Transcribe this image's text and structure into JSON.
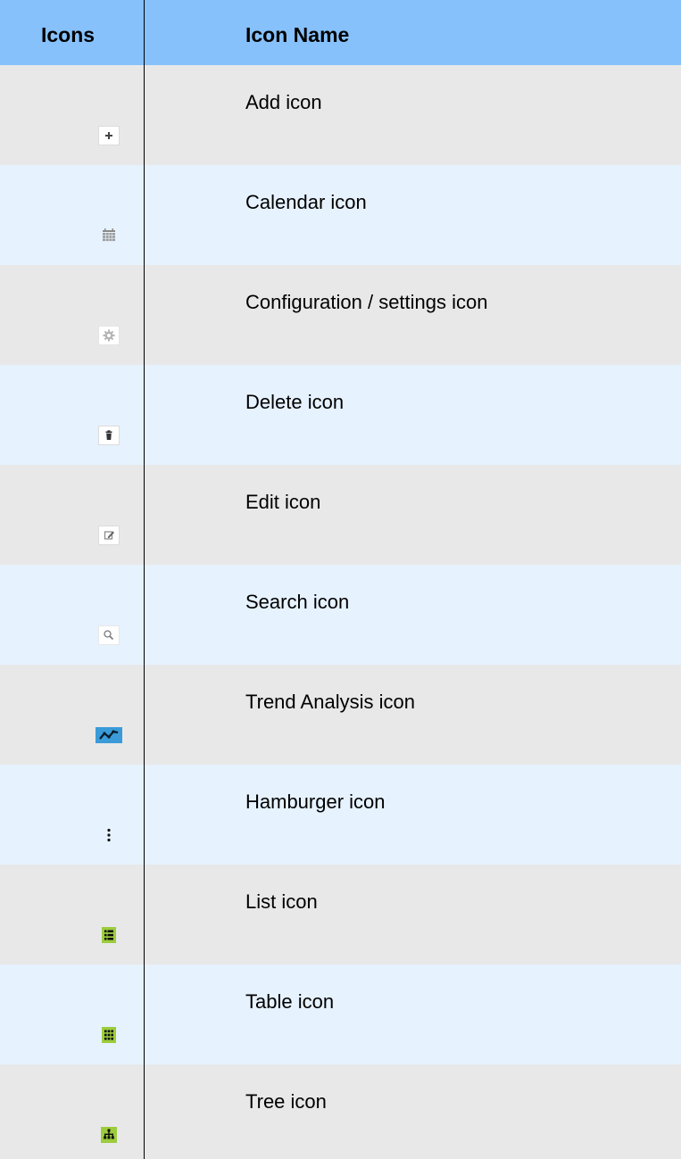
{
  "header": {
    "col_icons": "Icons",
    "col_name": "Icon Name"
  },
  "rows": [
    {
      "name": "Add icon",
      "icon": "plus-icon"
    },
    {
      "name": "Calendar icon",
      "icon": "calendar-icon"
    },
    {
      "name": "Configuration / settings icon",
      "icon": "gear-icon"
    },
    {
      "name": "Delete icon",
      "icon": "trash-icon"
    },
    {
      "name": "Edit icon",
      "icon": "edit-icon"
    },
    {
      "name": "Search icon",
      "icon": "search-icon"
    },
    {
      "name": "Trend Analysis icon",
      "icon": "trend-icon"
    },
    {
      "name": "Hamburger icon",
      "icon": "kebab-icon"
    },
    {
      "name": "List icon",
      "icon": "list-icon"
    },
    {
      "name": "Table icon",
      "icon": "table-icon"
    },
    {
      "name": "Tree icon",
      "icon": "tree-icon"
    }
  ],
  "colors": {
    "header": "#86c1fb",
    "row_gray": "#e8e8e8",
    "row_blue": "#e6f2fe",
    "trend_bg": "#3a9bd8",
    "green_bg": "#9ccc3c"
  }
}
